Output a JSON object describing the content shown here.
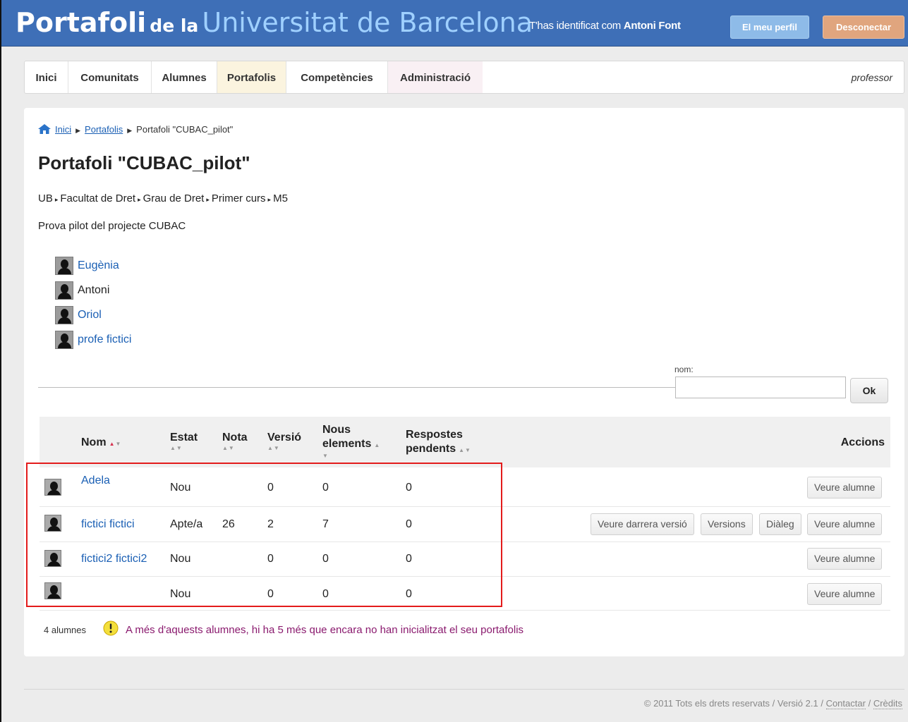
{
  "header": {
    "brand_1": "Portafoli",
    "brand_2": "de la",
    "brand_3": "Universitat de Barcelona",
    "identified_prefix": "T'has identificat com",
    "user_name": "Antoni Font",
    "profile_button": "El meu perfil",
    "logout_button": "Desconectar"
  },
  "nav": {
    "items": [
      "Inici",
      "Comunitats",
      "Alumnes",
      "Portafolis",
      "Competències",
      "Administració"
    ],
    "role": "professor"
  },
  "breadcrumb": {
    "home": "Inici",
    "portafolis": "Portafolis",
    "current": "Portafoli \"CUBAC_pilot\""
  },
  "page": {
    "title": "Portafoli \"CUBAC_pilot\"",
    "path": [
      "UB",
      "Facultat de Dret",
      "Grau de Dret",
      "Primer curs",
      "M5"
    ],
    "description": "Prova pilot del projecte CUBAC"
  },
  "teachers": [
    {
      "name": "Eugènia",
      "link": true
    },
    {
      "name": "Antoni",
      "link": false
    },
    {
      "name": "Oriol",
      "link": true
    },
    {
      "name": "profe fictici",
      "link": true
    }
  ],
  "filter": {
    "label": "nom:",
    "value": "",
    "button": "Ok"
  },
  "table": {
    "headers": {
      "nom": "Nom",
      "estat": "Estat",
      "nota": "Nota",
      "versio": "Versió",
      "nous_1": "Nous",
      "nous_2": "elements",
      "resp_1": "Respostes",
      "resp_2": "pendents",
      "accions": "Accions"
    },
    "rows": [
      {
        "nom": "Adela",
        "estat": "Nou",
        "nota": "",
        "versio": "0",
        "nous": "0",
        "respostes": "0",
        "actions": [
          "Veure alumne"
        ]
      },
      {
        "nom": "fictici fictici",
        "estat": "Apte/a",
        "nota": "26",
        "versio": "2",
        "nous": "7",
        "respostes": "0",
        "actions": [
          "Veure darrera versió",
          "Versions",
          "Diàleg",
          "Veure alumne"
        ]
      },
      {
        "nom": "fictici2 fictici2",
        "estat": "Nou",
        "nota": "",
        "versio": "0",
        "nous": "0",
        "respostes": "0",
        "actions": [
          "Veure alumne"
        ]
      },
      {
        "nom": "",
        "estat": "Nou",
        "nota": "",
        "versio": "0",
        "nous": "0",
        "respostes": "0",
        "actions": [
          "Veure alumne"
        ]
      }
    ]
  },
  "summary": {
    "count": "4 alumnes",
    "notice": "A més d'aquests alumnes, hi ha 5 més que encara no han inicialitzat el seu portafolis"
  },
  "footer": {
    "copyright": "© 2011 Tots els drets reservats / Versió 2.1 /",
    "contact": "Contactar",
    "slash": "/",
    "credits": "Crèdits"
  },
  "colors": {
    "header_bg": "#3e6fb7",
    "link": "#1a5fb4",
    "highlight_border": "#e31b1b",
    "notice_text": "#8a1a6e"
  }
}
